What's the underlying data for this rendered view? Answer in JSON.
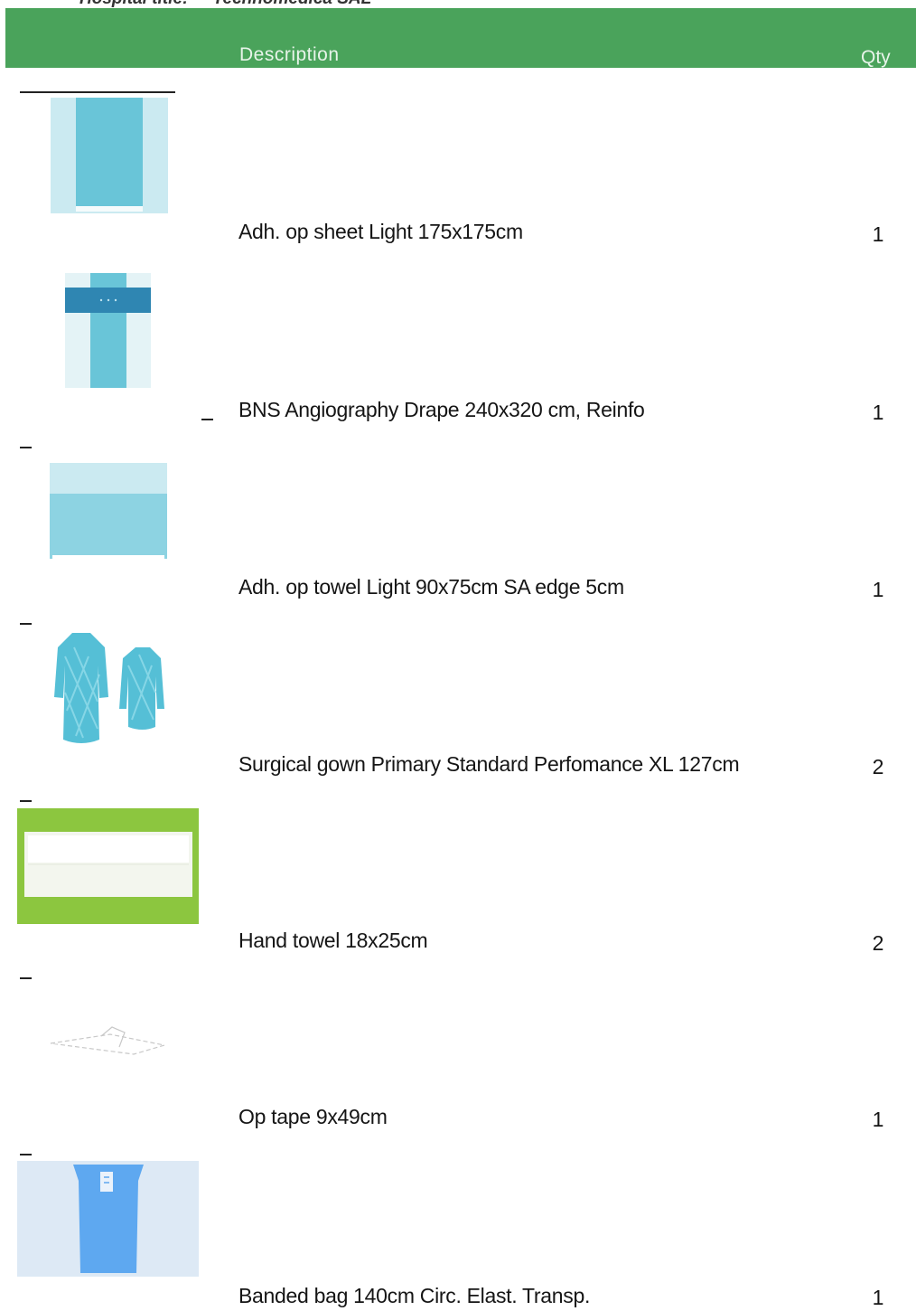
{
  "header": {
    "hospital_label": "Hospital title:",
    "hospital_value": "Technomedica SAL"
  },
  "columns": {
    "description": "Description",
    "qty": "Qty"
  },
  "items": [
    {
      "description": "Adh. op sheet Light 175x175cm",
      "qty": "1",
      "image": "drape-sheet-image"
    },
    {
      "description": "BNS Angiography Drape 240x320 cm, Reinfo",
      "qty": "1",
      "image": "angiography-drape-image"
    },
    {
      "description": "Adh. op towel Light 90x75cm SA edge 5cm",
      "qty": "1",
      "image": "op-towel-image"
    },
    {
      "description": "Surgical gown Primary Standard Perfomance XL 127cm",
      "qty": "2",
      "image": "surgical-gown-image"
    },
    {
      "description": "Hand towel 18x25cm",
      "qty": "2",
      "image": "hand-towel-image"
    },
    {
      "description": "Op tape 9x49cm",
      "qty": "1",
      "image": "op-tape-image"
    },
    {
      "description": "Banded bag 140cm Circ. Elast. Transp.",
      "qty": "1",
      "image": "banded-bag-image"
    }
  ],
  "colors": {
    "header_green": "#4aa35b",
    "drape_teal": "#69c5d8",
    "drape_light": "#cbeaf1",
    "towel_green": "#8cc63f",
    "bag_blue": "#5ea8f0"
  }
}
